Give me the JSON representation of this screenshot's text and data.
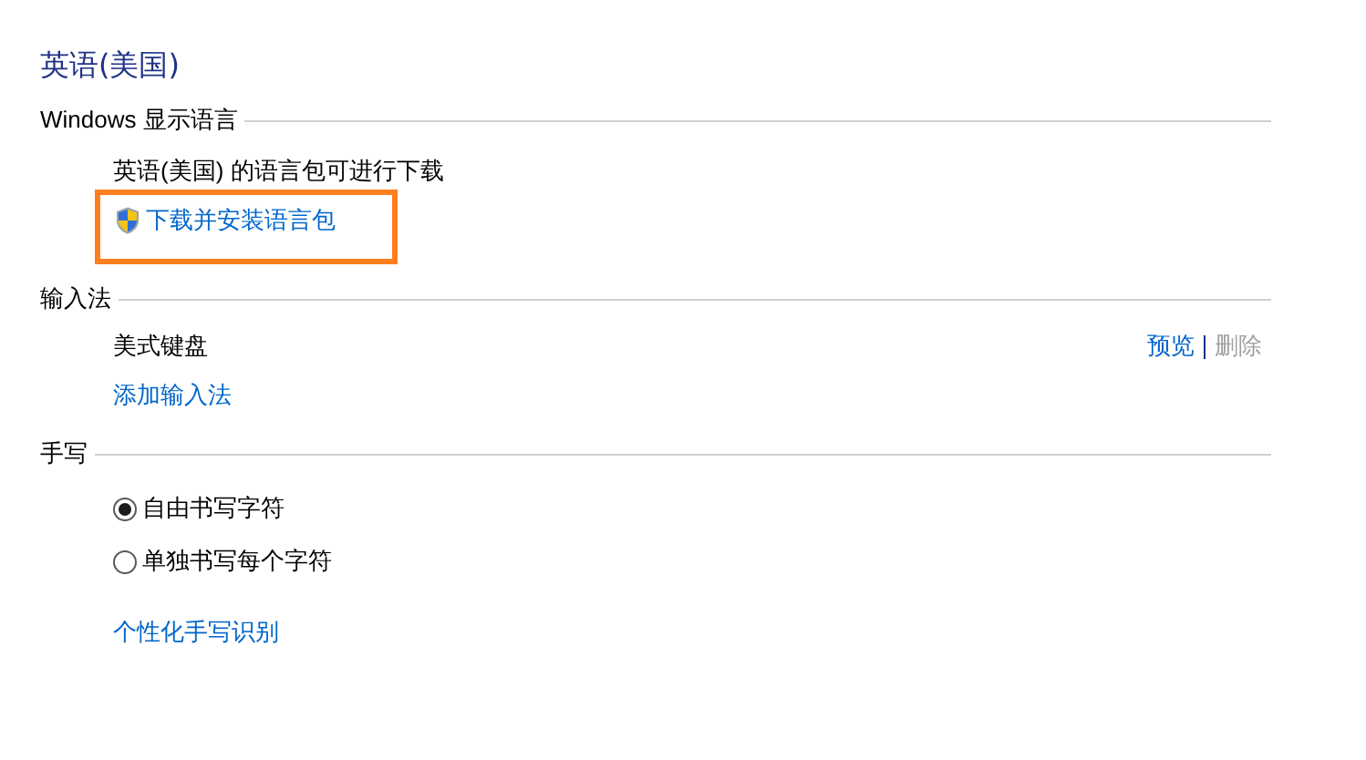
{
  "title": "英语(美国)",
  "display_language": {
    "heading": "Windows 显示语言",
    "message": "英语(美国) 的语言包可进行下载",
    "download_link": {
      "label": "下载并安装语言包",
      "highlighted": true
    }
  },
  "input_method": {
    "heading": "输入法",
    "items": [
      {
        "name": "美式键盘",
        "actions": [
          {
            "label": "预览",
            "disabled": false
          },
          {
            "label": "删除",
            "disabled": true
          }
        ]
      }
    ],
    "add_link": "添加输入法"
  },
  "handwriting": {
    "heading": "手写",
    "options": [
      {
        "label": "自由书写字符",
        "selected": true
      },
      {
        "label": "单独书写每个字符",
        "selected": false
      }
    ],
    "personalize_link": "个性化手写识别"
  }
}
